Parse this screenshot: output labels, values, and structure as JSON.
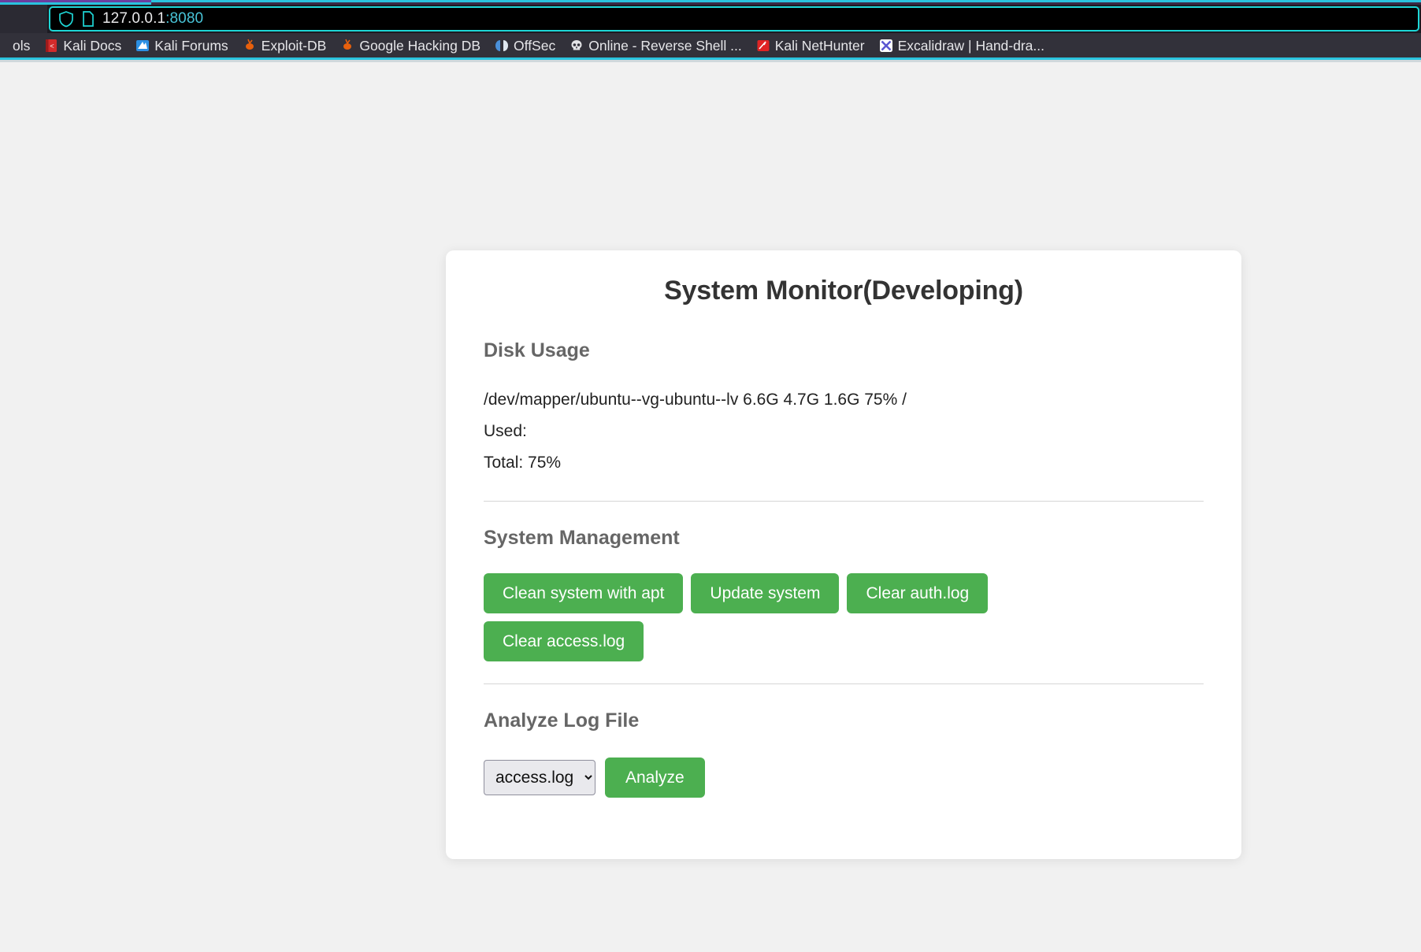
{
  "browser": {
    "url_host": "127.0.0.1",
    "url_port": ":8080",
    "shield_icon": "shield-icon",
    "page_icon": "page-document-icon",
    "bookmarks": [
      {
        "label": "ols",
        "icon": "partial-bookmark-icon"
      },
      {
        "label": "Kali Docs",
        "icon": "kali-docs-book-icon"
      },
      {
        "label": "Kali Forums",
        "icon": "kali-forums-icon"
      },
      {
        "label": "Exploit-DB",
        "icon": "exploit-db-icon"
      },
      {
        "label": "Google Hacking DB",
        "icon": "google-hacking-db-icon"
      },
      {
        "label": "OffSec",
        "icon": "offsec-icon"
      },
      {
        "label": "Online - Reverse Shell ...",
        "icon": "skull-icon"
      },
      {
        "label": "Kali NetHunter",
        "icon": "kali-nethunter-icon"
      },
      {
        "label": "Excalidraw | Hand-dra...",
        "icon": "excalidraw-icon"
      }
    ]
  },
  "page": {
    "title": "System Monitor(Developing)",
    "disk": {
      "heading": "Disk Usage",
      "line1": "/dev/mapper/ubuntu--vg-ubuntu--lv 6.6G 4.7G 1.6G 75% /",
      "line2": "Used:",
      "line3": "Total: 75%"
    },
    "management": {
      "heading": "System Management",
      "buttons": [
        "Clean system with apt",
        "Update system",
        "Clear auth.log",
        "Clear access.log"
      ]
    },
    "analyze": {
      "heading": "Analyze Log File",
      "selected_option": "access.log",
      "options": [
        "access.log"
      ],
      "button": "Analyze"
    }
  },
  "colors": {
    "accent_green": "#4caf50",
    "page_bg": "#f1f1f1",
    "card_bg": "#ffffff",
    "heading_gray": "#666666",
    "chrome_bg": "#2b2a33",
    "urlbar_border": "#1ed6d6"
  }
}
